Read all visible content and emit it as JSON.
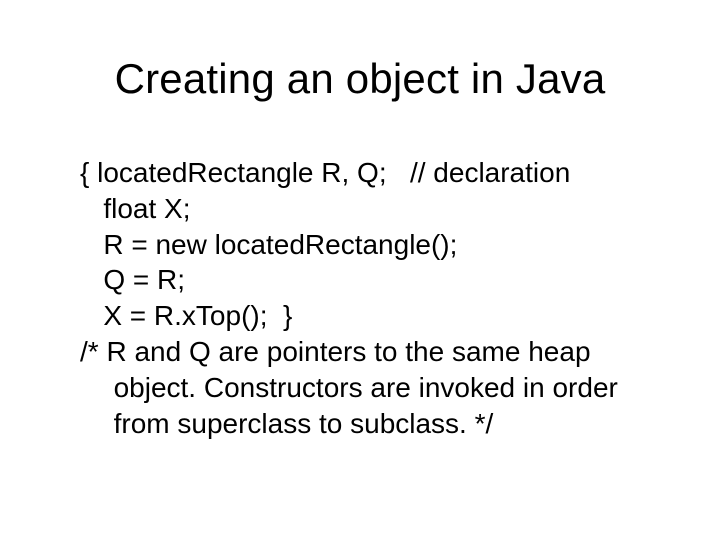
{
  "title": "Creating an object in Java",
  "code": {
    "l1": "{ locatedRectangle R, Q;   // declaration",
    "l2": "   float X;",
    "l3": "   R = new locatedRectangle();",
    "l4": "   Q = R;",
    "l5": "   X = R.xTop();  }"
  },
  "comment": "/* R and Q are pointers to the same heap object.  Constructors are invoked in order from superclass to subclass. */"
}
